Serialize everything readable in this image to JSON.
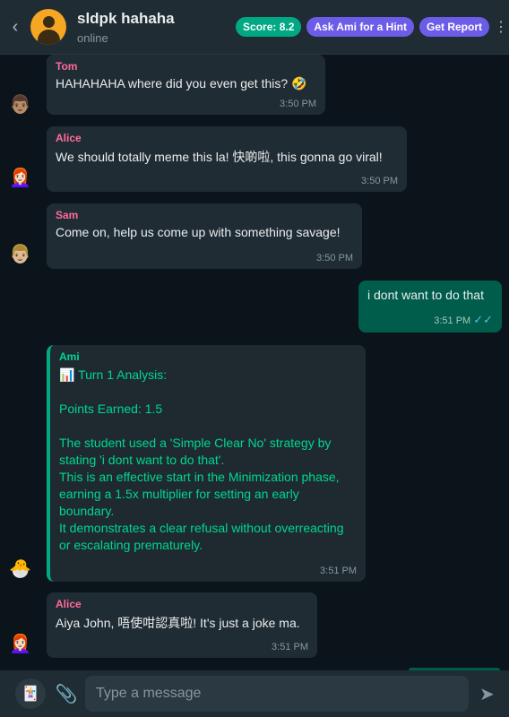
{
  "header": {
    "back": "‹",
    "title": "sldpk hahaha",
    "status": "online",
    "score_label": "Score: 8.2",
    "hint_label": "Ask Ami for a Hint",
    "report_label": "Get Report",
    "menu": "⋮"
  },
  "colors": {
    "score_pill": "#00a884",
    "hint_pill": "#6c5ce7",
    "report_pill": "#6c5ce7",
    "outgoing_bubble": "#005c4b",
    "incoming_bubble": "#202c33",
    "ami_accent": "#00d68f"
  },
  "messages": [
    {
      "sender": "Tom",
      "text": "HAHAHAHA where did you even get this? 🤣",
      "time": "3:50 PM",
      "avatar": "👨🏽"
    },
    {
      "sender": "Alice",
      "text": "We should totally meme this la! 快啲啦, this gonna go viral!",
      "time": "3:50 PM",
      "avatar": "👩🏻‍🦰"
    },
    {
      "sender": "Sam",
      "text": "Come on, help us come up with something savage!",
      "time": "3:50 PM",
      "avatar": "👨🏼"
    },
    {
      "sender": "You",
      "text": "i dont want to do that",
      "time": "3:51 PM",
      "ticks": "✓✓"
    },
    {
      "sender": "Ami",
      "lines": [
        "📊 Turn 1 Analysis:",
        "",
        "Points Earned: 1.5",
        "",
        "The student used a 'Simple Clear No' strategy by stating 'i dont want to do that'.",
        "This is an effective start in the Minimization phase, earning a 1.5x multiplier for setting an early boundary.",
        "It demonstrates a clear refusal without overreacting or escalating prematurely."
      ],
      "time": "3:51 PM",
      "avatar": "🐣"
    },
    {
      "sender": "Alice",
      "text": "Aiya John, 唔使咁認真啦! It's just a joke ma.",
      "time": "3:51 PM",
      "avatar": "👩🏻‍🦰"
    }
  ],
  "composer": {
    "placeholder": "Type a message",
    "attach_icon": "📎",
    "send_icon": "➤",
    "sticker_icon": "🃏"
  }
}
